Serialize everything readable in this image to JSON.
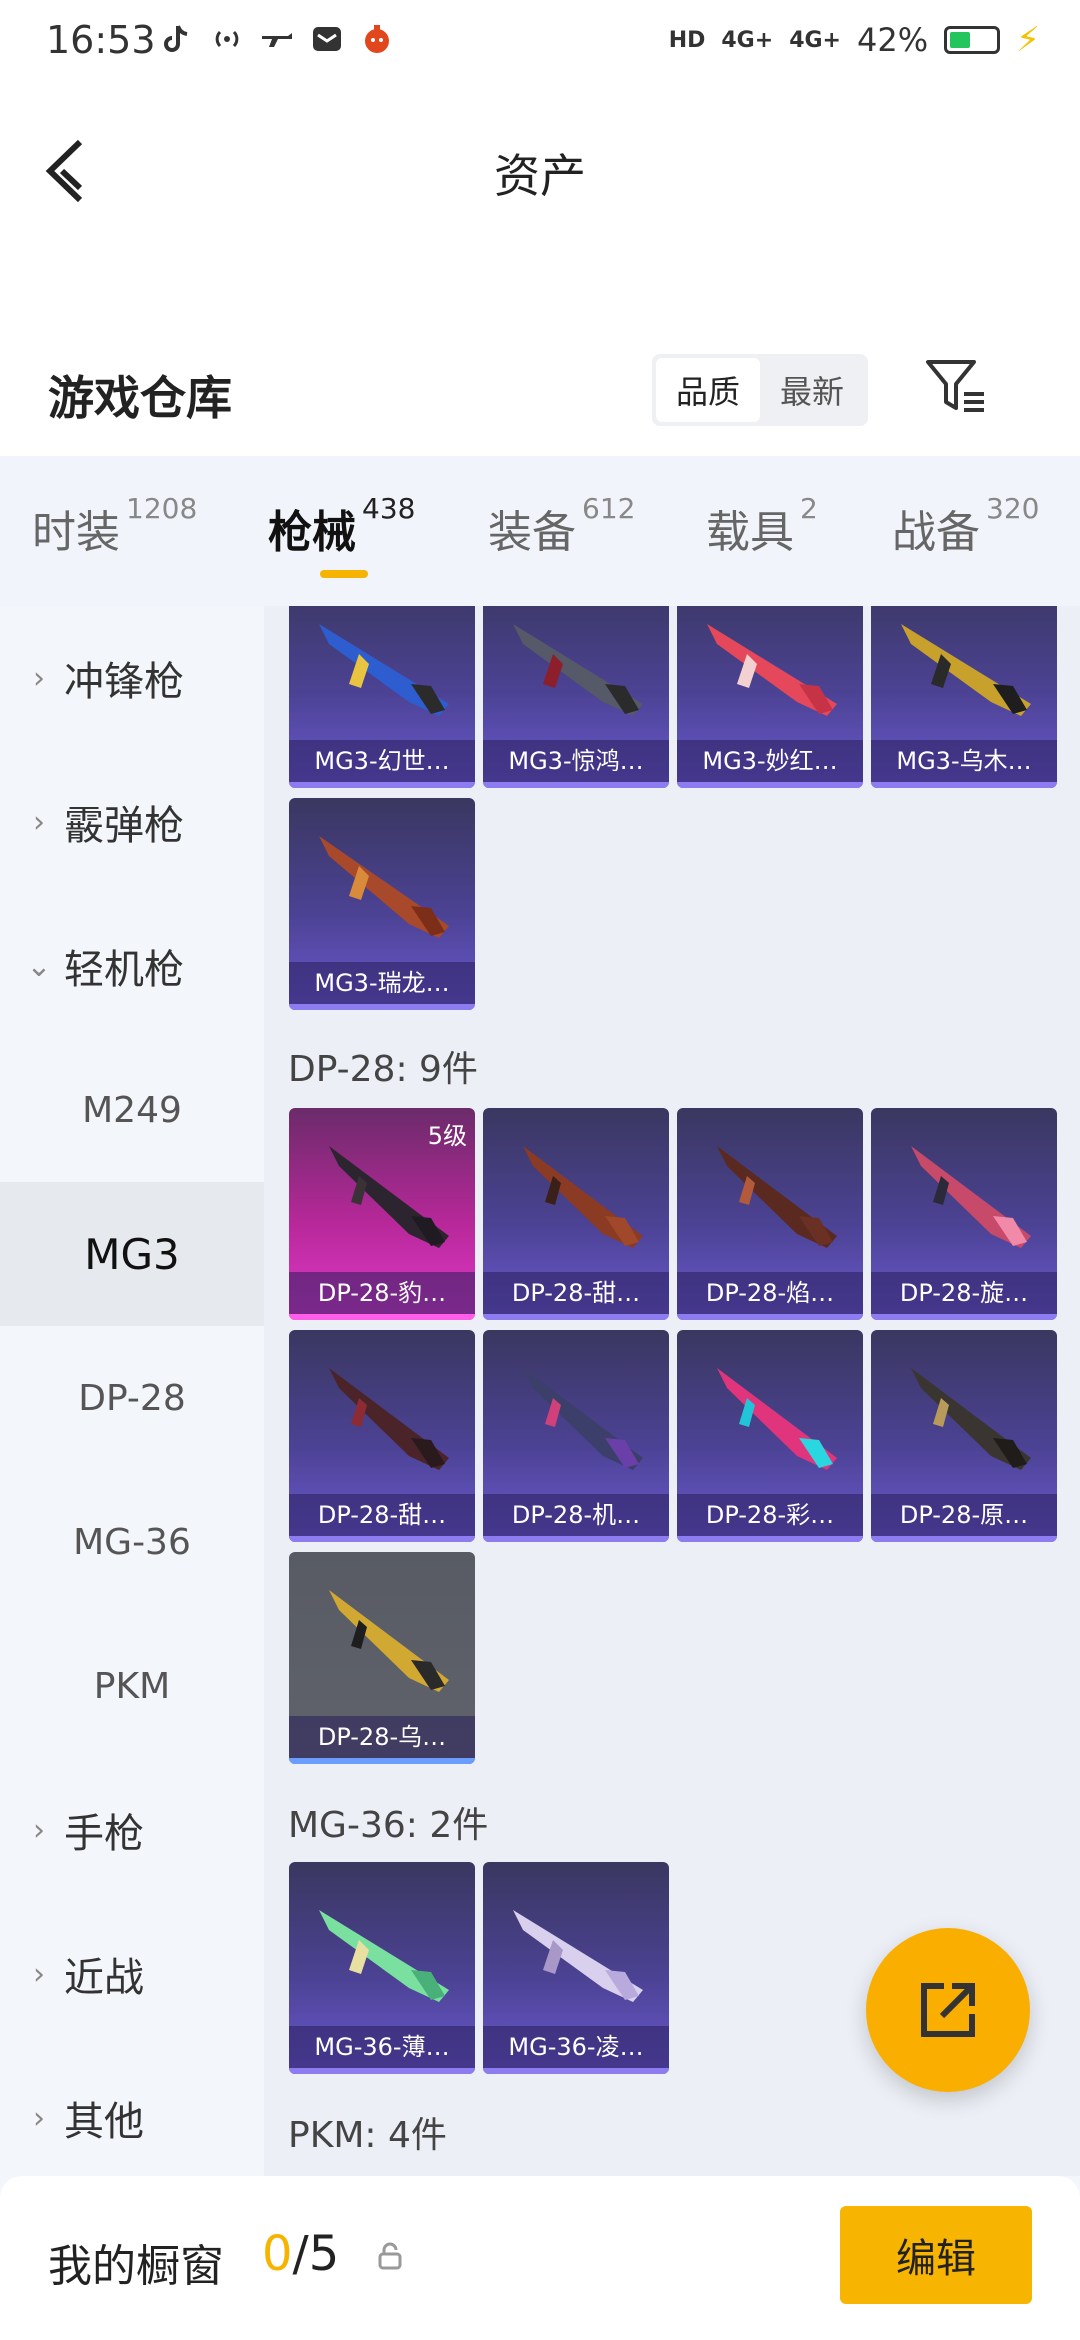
{
  "status_bar": {
    "time": "16:53",
    "network_1": "4G+",
    "network_2": "4G+",
    "hd": "HD",
    "battery": "42%"
  },
  "header": {
    "title": "资产"
  },
  "warehouse": {
    "title": "游戏仓库",
    "sort_options": [
      "品质",
      "最新"
    ],
    "active_sort": "品质"
  },
  "tabs": [
    {
      "label": "时装",
      "count": "1208"
    },
    {
      "label": "枪械",
      "count": "438"
    },
    {
      "label": "装备",
      "count": "612"
    },
    {
      "label": "载具",
      "count": "2"
    },
    {
      "label": "战备",
      "count": "320"
    }
  ],
  "sidebar": {
    "items": [
      {
        "label": "冲锋枪"
      },
      {
        "label": "霰弹枪"
      },
      {
        "label": "轻机枪"
      },
      {
        "label": "M249"
      },
      {
        "label": "MG3"
      },
      {
        "label": "DP-28"
      },
      {
        "label": "MG-36"
      },
      {
        "label": "PKM"
      },
      {
        "label": "手枪"
      },
      {
        "label": "近战"
      },
      {
        "label": "其他"
      }
    ]
  },
  "content": {
    "mg3_items": [
      {
        "label": "MG3-幻世…"
      },
      {
        "label": "MG3-惊鸿…"
      },
      {
        "label": "MG3-妙红…"
      },
      {
        "label": "MG3-乌木…"
      },
      {
        "label": "MG3-瑞龙…"
      }
    ],
    "dp28_title": "DP-28: 9件",
    "dp28_items": [
      {
        "label": "DP-28-豹…",
        "level": "5级"
      },
      {
        "label": "DP-28-甜…"
      },
      {
        "label": "DP-28-焰…"
      },
      {
        "label": "DP-28-旋…"
      },
      {
        "label": "DP-28-甜…"
      },
      {
        "label": "DP-28-机…"
      },
      {
        "label": "DP-28-彩…"
      },
      {
        "label": "DP-28-原…"
      },
      {
        "label": "DP-28-乌…"
      }
    ],
    "mg36_title": "MG-36: 2件",
    "mg36_items": [
      {
        "label": "MG-36-薄…"
      },
      {
        "label": "MG-36-凌…"
      }
    ],
    "pkm_title": "PKM: 4件"
  },
  "bottom_bar": {
    "label": "我的橱窗",
    "current": "0",
    "total": "/5",
    "edit_label": "编辑"
  },
  "colors": {
    "accent": "#f7b400",
    "card_purple": "#4c4294",
    "card_pink": "#e13acb"
  }
}
